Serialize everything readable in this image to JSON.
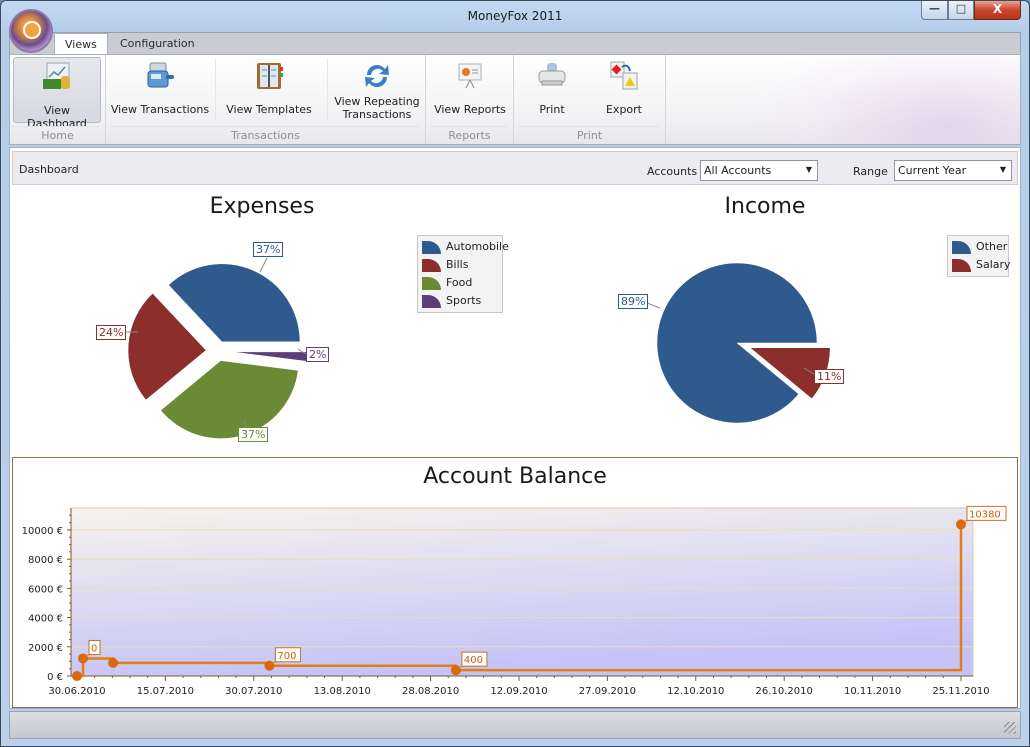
{
  "window": {
    "title": "MoneyFox 2011",
    "controls": {
      "minimize": "—",
      "maximize": "□",
      "close": "X"
    }
  },
  "ribbon": {
    "tabs": [
      {
        "label": "Views",
        "active": true
      },
      {
        "label": "Configuration",
        "active": false
      }
    ],
    "groups": [
      {
        "label": "Home",
        "buttons": [
          {
            "label": "View Dashboard",
            "icon": "dashboard-icon",
            "active": true
          }
        ]
      },
      {
        "label": "Transactions",
        "buttons": [
          {
            "label": "View Transactions",
            "icon": "cash-register-icon"
          },
          {
            "label": "View Templates",
            "icon": "binder-icon"
          },
          {
            "label_line1": "View Repeating",
            "label_line2": "Transactions",
            "icon": "repeat-arrows-icon"
          }
        ]
      },
      {
        "label": "Reports",
        "buttons": [
          {
            "label": "View Reports",
            "icon": "presentation-chart-icon"
          }
        ]
      },
      {
        "label": "Print",
        "buttons": [
          {
            "label": "Print",
            "icon": "printer-icon"
          },
          {
            "label": "Export",
            "icon": "export-icon"
          }
        ]
      }
    ]
  },
  "dashboard": {
    "title": "Dashboard",
    "accounts_label": "Accounts",
    "accounts_value": "All Accounts",
    "range_label": "Range",
    "range_value": "Current Year"
  },
  "chart_data": [
    {
      "type": "pie",
      "title": "Expenses",
      "legend_position": "top-right",
      "slices": [
        {
          "label": "Automobile",
          "value": 37,
          "display": "37%",
          "color": "#2f5a8e"
        },
        {
          "label": "Bills",
          "value": 24,
          "display": "24%",
          "color": "#8b2e2c"
        },
        {
          "label": "Food",
          "value": 37,
          "display": "37%",
          "color": "#6b8a35"
        },
        {
          "label": "Sports",
          "value": 2,
          "display": "2%",
          "color": "#5a3f7a"
        }
      ]
    },
    {
      "type": "pie",
      "title": "Income",
      "legend_position": "top-right",
      "slices": [
        {
          "label": "Other",
          "value": 89,
          "display": "89%",
          "color": "#2f5a8e"
        },
        {
          "label": "Salary",
          "value": 11,
          "display": "11%",
          "color": "#8b2e2c"
        }
      ]
    },
    {
      "type": "line",
      "title": "Account Balance",
      "step": true,
      "xlabel": "",
      "ylabel": "",
      "x_ticks": [
        "30.06.2010",
        "15.07.2010",
        "30.07.2010",
        "13.08.2010",
        "28.08.2010",
        "12.09.2010",
        "27.09.2010",
        "12.10.2010",
        "26.10.2010",
        "10.11.2010",
        "25.11.2010"
      ],
      "y_ticks": [
        "0 €",
        "2000 €",
        "4000 €",
        "6000 €",
        "8000 €",
        "10000 €"
      ],
      "ylim": [
        0,
        11500
      ],
      "xlim_days": [
        0,
        148
      ],
      "grid": true,
      "color": "#e87b12",
      "points": [
        {
          "day": 0,
          "value": 0,
          "label": ""
        },
        {
          "day": 1,
          "value": 1200,
          "label": "0"
        },
        {
          "day": 6,
          "value": 900,
          "label": ""
        },
        {
          "day": 32,
          "value": 700,
          "label": "700"
        },
        {
          "day": 63,
          "value": 400,
          "label": "400"
        },
        {
          "day": 147,
          "value": 10380,
          "label": "10380"
        }
      ]
    }
  ]
}
